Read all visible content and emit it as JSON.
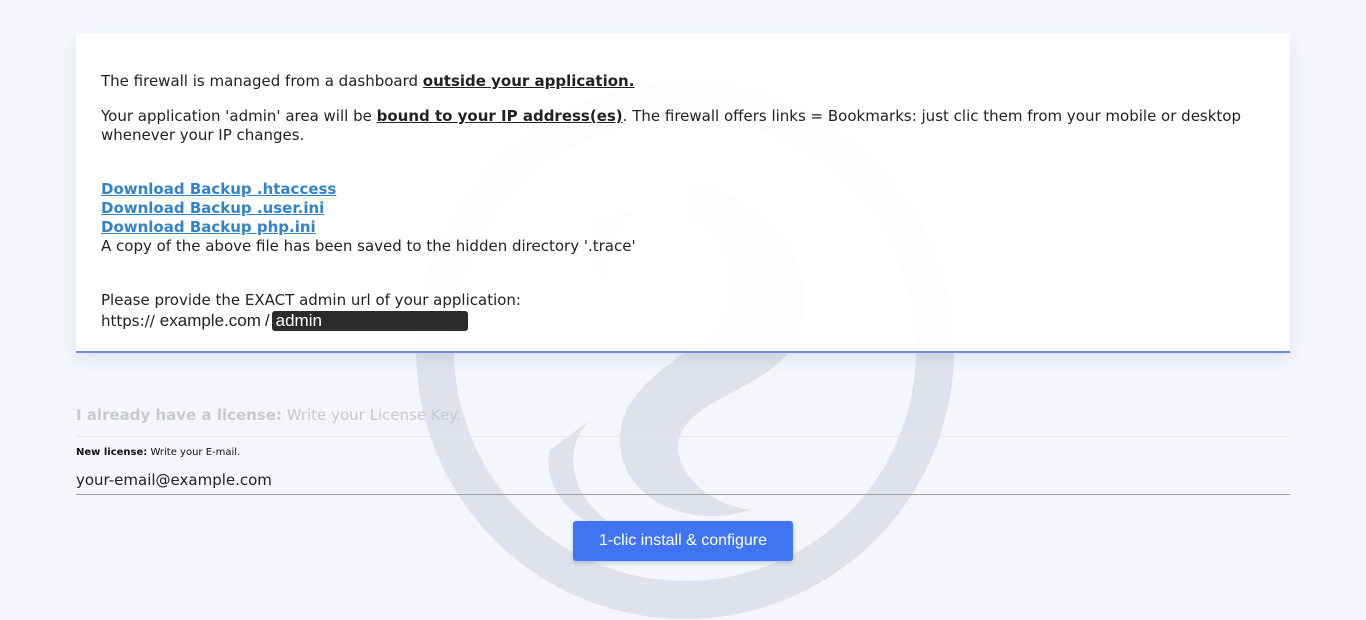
{
  "intro": {
    "line1_prefix": "The firewall is managed from a dashboard ",
    "line1_emphasis": "outside your application.",
    "line2_prefix": "Your application 'admin' area will be ",
    "line2_emphasis": "bound to your IP address(es)",
    "line2_suffix": ". The firewall offers links = Bookmarks: just clic them from your mobile or desktop whenever your IP changes."
  },
  "downloads": {
    "links": [
      "Download Backup .htaccess",
      "Download Backup .user.ini",
      "Download Backup php.ini"
    ],
    "note": "A copy of the above file has been saved to the hidden directory '.trace'"
  },
  "admin_url": {
    "prompt": "Please provide the EXACT admin url of your application:",
    "scheme": "https://",
    "domain": "example.com",
    "slash": "/",
    "value": "admin"
  },
  "license": {
    "have_bold": "I already have a license:",
    "have_text": " Write your License Key.",
    "new_bold": "New license:",
    "new_text": " Write your E-mail.",
    "email_value": "your-email@example.com"
  },
  "actions": {
    "install_label": "1-clic install & configure"
  },
  "colors": {
    "accent": "#4174f0",
    "link": "#3483c9",
    "card_border": "#6b8de3"
  },
  "icons": {
    "watermark": "dragon-logo-icon"
  }
}
